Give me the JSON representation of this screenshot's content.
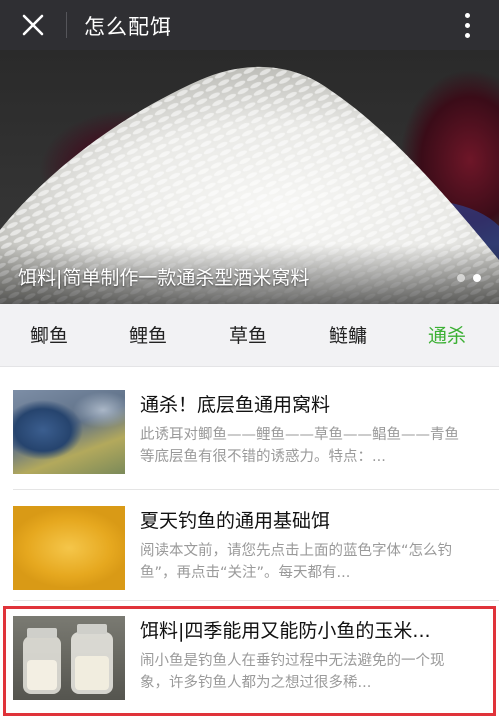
{
  "header": {
    "title": "怎么配饵",
    "close_icon": "close-icon",
    "more_icon": "more-vertical-icon",
    "bg_color": "#2f2f33"
  },
  "banner": {
    "title": "饵料|简单制作一款通杀型酒米窝料",
    "slide_count": 2,
    "active_slide": 2
  },
  "tabs": {
    "items": [
      "鲫鱼",
      "鲤鱼",
      "草鱼",
      "鲢鳙",
      "通杀"
    ],
    "active": "通杀",
    "active_color": "#3cb034"
  },
  "articles": [
    {
      "title": "通杀！底层鱼通用窝料",
      "desc": "此诱耳对鲫鱼——鲤鱼——草鱼——鲳鱼——青鱼等底层鱼有很不错的诱惑力。特点：..."
    },
    {
      "title": "夏天钓鱼的通用基础饵",
      "desc": "阅读本文前，请您先点击上面的蓝色字体“怎么钓鱼”，再点击“关注”。每天都有..."
    },
    {
      "title": "饵料|四季能用又能防小鱼的玉米...",
      "desc": "闹小鱼是钓鱼人在垂钓过程中无法避免的一个现象，许多钓鱼人都为之想过很多稀..."
    }
  ],
  "highlight_color": "#e0333a"
}
